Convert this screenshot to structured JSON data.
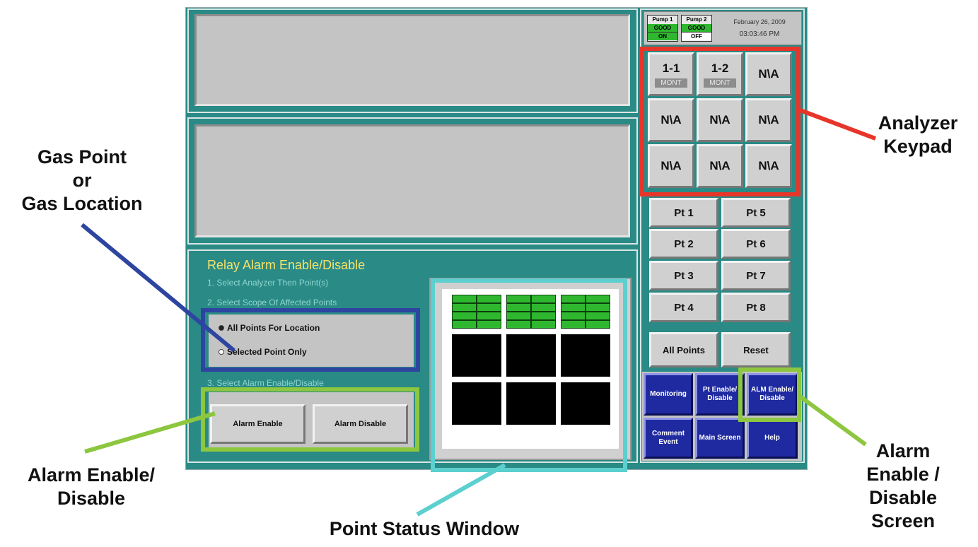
{
  "status_bar": {
    "pump1_label": "Pump 1",
    "pump1_health": "GOOD",
    "pump1_state": "ON",
    "pump2_label": "Pump 2",
    "pump2_health": "GOOD",
    "pump2_state": "OFF",
    "date": "February 26, 2009",
    "time": "03:03:46 PM"
  },
  "analyzer_keypad": {
    "keys": [
      {
        "label": "1-1",
        "sub": "MONT"
      },
      {
        "label": "1-2",
        "sub": "MONT"
      },
      {
        "label": "N\\A"
      },
      {
        "label": "N\\A"
      },
      {
        "label": "N\\A"
      },
      {
        "label": "N\\A"
      },
      {
        "label": "N\\A"
      },
      {
        "label": "N\\A"
      },
      {
        "label": "N\\A"
      }
    ]
  },
  "points": [
    "Pt 1",
    "Pt 5",
    "Pt 2",
    "Pt 6",
    "Pt 3",
    "Pt 7",
    "Pt 4",
    "Pt 8"
  ],
  "point_actions": {
    "all_points": "All Points",
    "reset": "Reset"
  },
  "nav": [
    "Monitoring",
    "Pt Enable/ Disable",
    "ALM Enable/ Disable",
    "Comment Event",
    "Main Screen",
    "Help"
  ],
  "relay": {
    "title": "Relay Alarm Enable/Disable",
    "step1": "1.  Select Analyzer Then Point(s)",
    "step2": "2.  Select Scope Of Affected Points",
    "step3": "3.  Select Alarm Enable/Disable",
    "option_all": "All Points For Location",
    "option_selected": "Selected Point Only",
    "enable": "Alarm Enable",
    "disable": "Alarm Disable"
  },
  "callouts": {
    "gas_point_line1": "Gas Point",
    "gas_point_line2": "or",
    "gas_point_line3": "Gas Location",
    "analyzer_line1": "Analyzer",
    "analyzer_line2": "Keypad",
    "alarm_ed_line1": "Alarm Enable/",
    "alarm_ed_line2": "Disable",
    "alarm_screen_line1": "Alarm",
    "alarm_screen_line2": "Enable /",
    "alarm_screen_line3": "Disable",
    "alarm_screen_line4": "Screen",
    "point_status": "Point Status Window"
  },
  "colors": {
    "panel_teal": "#2a8a86",
    "callout_red": "#e8352a",
    "callout_blue": "#2e45a0",
    "callout_green": "#8dc63f",
    "callout_cyan": "#5ccfcf",
    "status_green": "#2fb82f",
    "nav_blue": "#1f2aa0"
  }
}
